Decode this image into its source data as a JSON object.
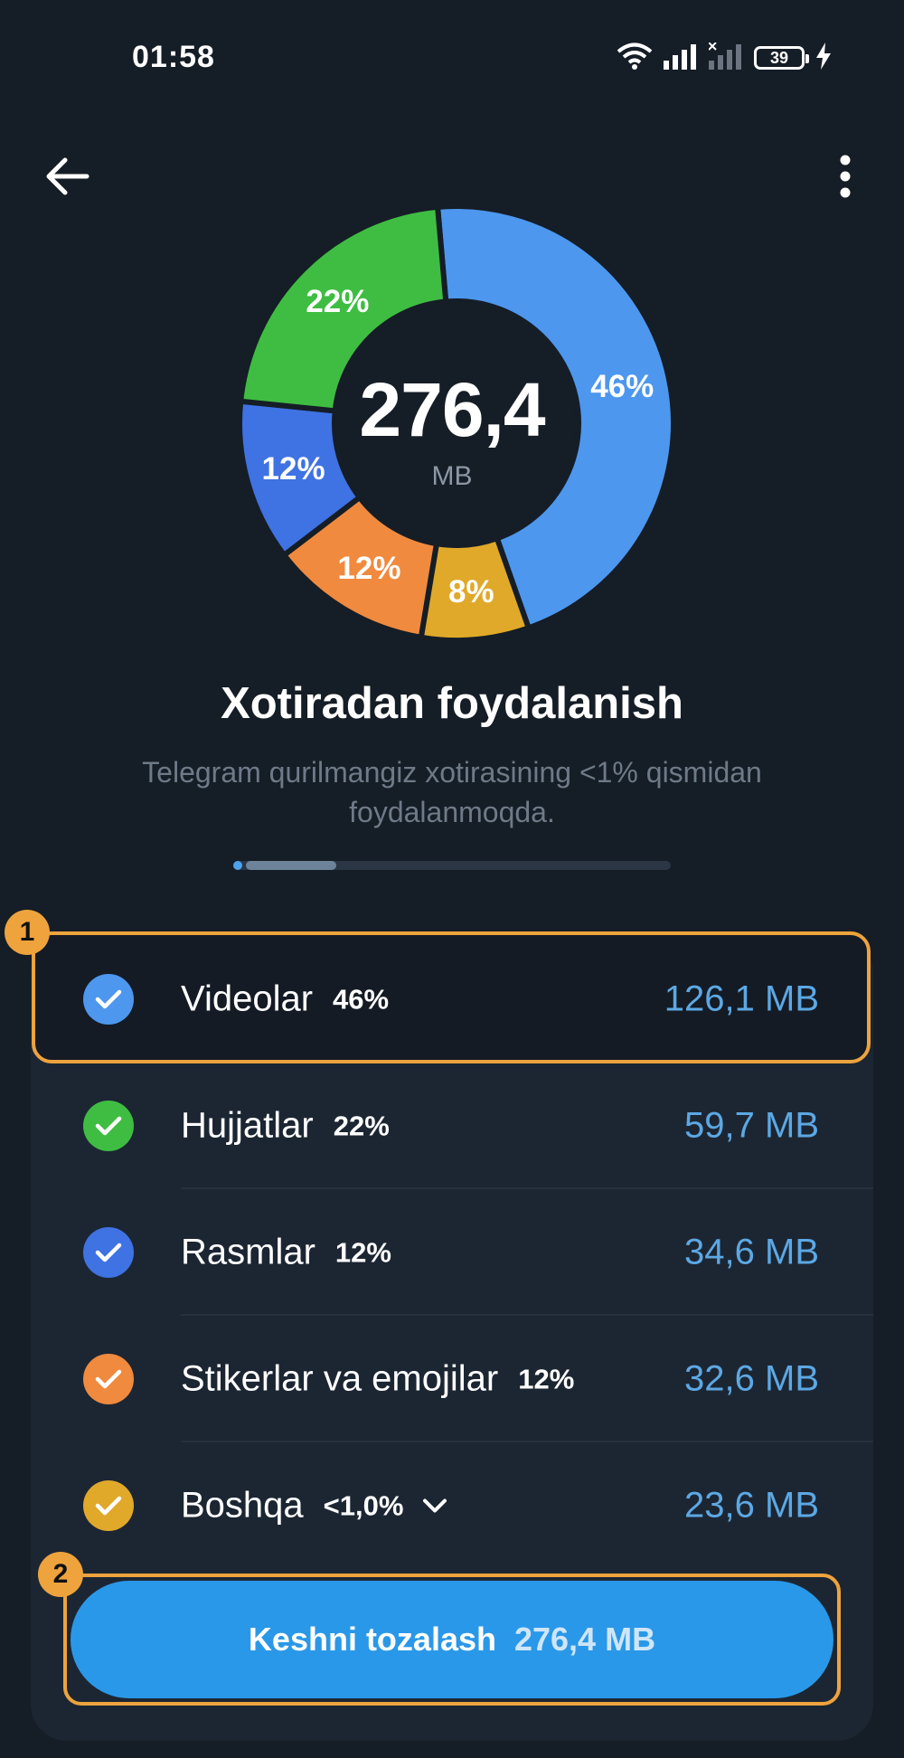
{
  "status_bar": {
    "time": "01:58",
    "battery": "39"
  },
  "header": {
    "back_icon": "arrow-left-icon",
    "menu_icon": "more-vertical-icon"
  },
  "chart_data": {
    "type": "pie",
    "center_value": "276,4",
    "center_unit": "MB",
    "slices": [
      {
        "label": "46%",
        "value": 46,
        "color": "#4d97ee"
      },
      {
        "label": "8%",
        "value": 8,
        "color": "#e0a92a"
      },
      {
        "label": "12%",
        "value": 12,
        "color": "#f08a3e"
      },
      {
        "label": "12%",
        "value": 12,
        "color": "#3f72e3"
      },
      {
        "label": "22%",
        "value": 22,
        "color": "#3fbd42"
      }
    ]
  },
  "main": {
    "title": "Xotiradan foydalanish",
    "subtitle": "Telegram qurilmangiz xotirasining <1% qismidan foydalanmoqda.",
    "progress": 0.01
  },
  "categories": [
    {
      "name": "Videolar",
      "percent": "46%",
      "size": "126,1 MB",
      "color": "#4d97ee"
    },
    {
      "name": "Hujjatlar",
      "percent": "22%",
      "size": "59,7 MB",
      "color": "#3fbd42"
    },
    {
      "name": "Rasmlar",
      "percent": "12%",
      "size": "34,6 MB",
      "color": "#3f72e3"
    },
    {
      "name": "Stikerlar va emojilar",
      "percent": "12%",
      "size": "32,6 MB",
      "color": "#f08a3e"
    },
    {
      "name": "Boshqa",
      "percent": "<1,0%",
      "size": "23,6 MB",
      "color": "#e0a92a"
    }
  ],
  "clear_button": {
    "label": "Keshni tozalash",
    "size": "276,4 MB"
  },
  "annotations": {
    "badge1": "1",
    "badge2": "2"
  }
}
